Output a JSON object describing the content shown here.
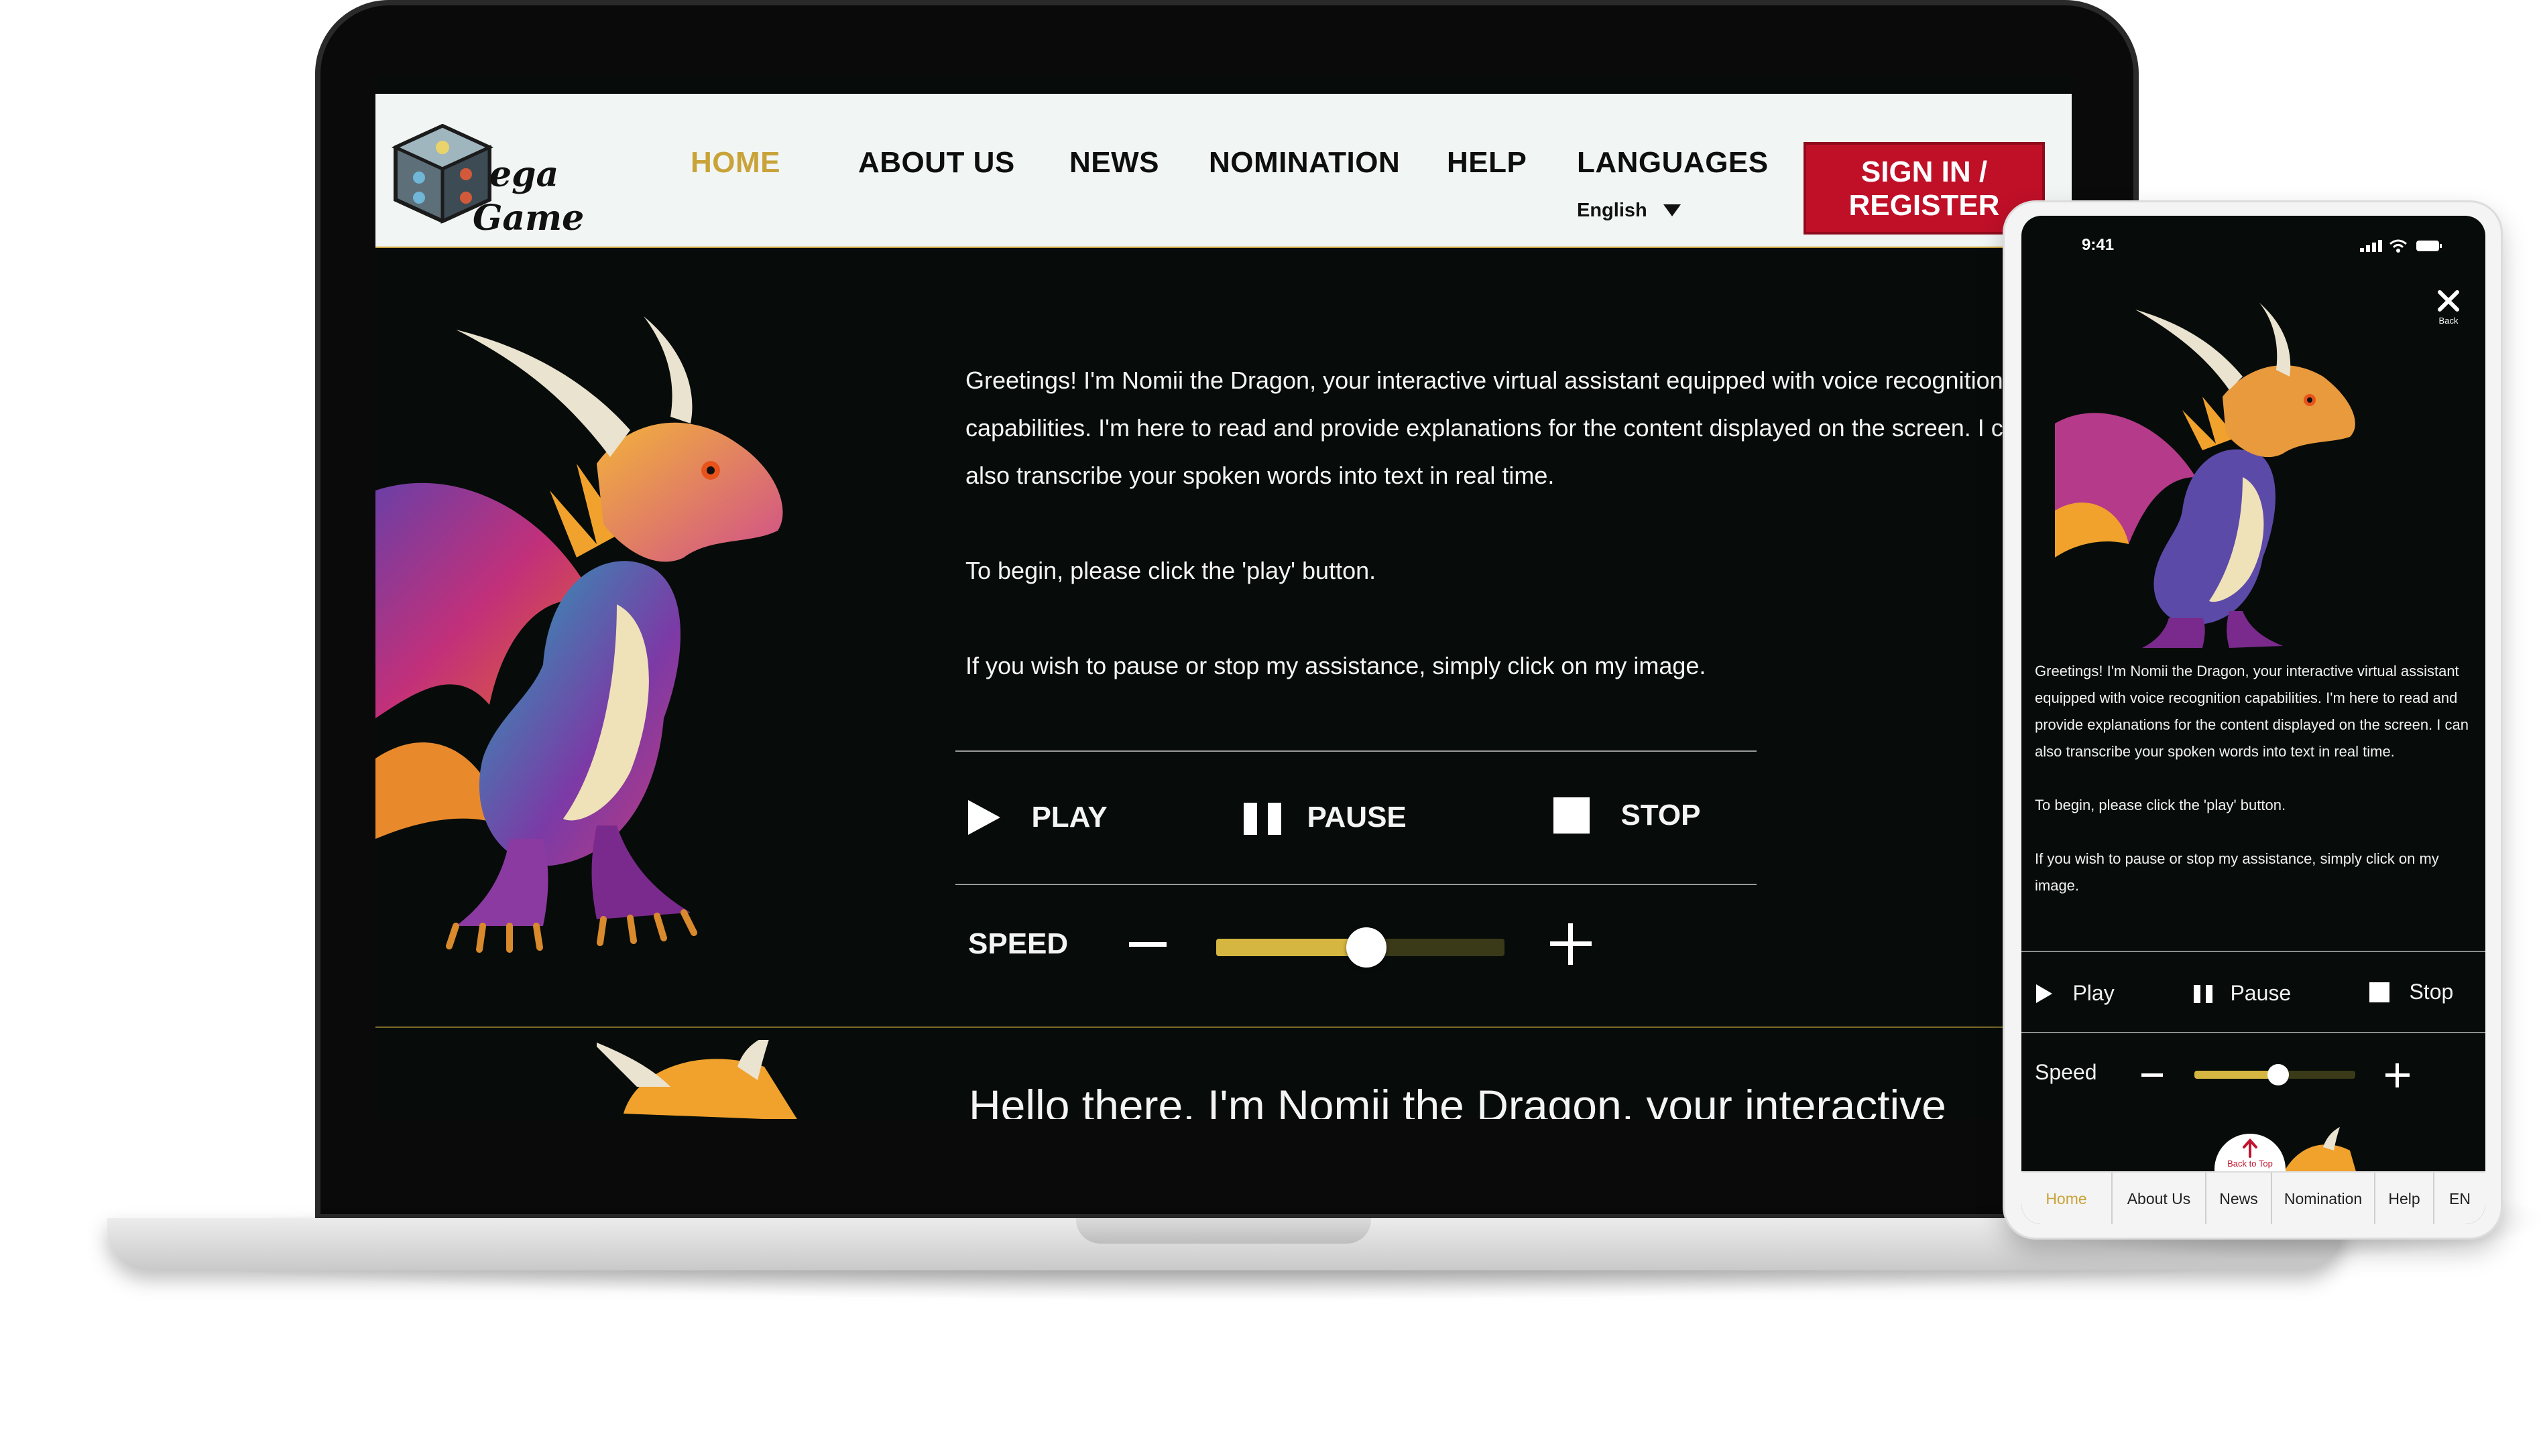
{
  "desktop": {
    "logo": {
      "text_line1": "ega",
      "text_line2": "Game"
    },
    "nav": {
      "home": "HOME",
      "about": "ABOUT US",
      "news": "NEWS",
      "nomination": "NOMINATION",
      "help": "HELP",
      "languages": "LANGUAGES",
      "language_value": "English",
      "signin_line1": "SIGN IN /",
      "signin_line2": "REGISTER"
    },
    "intro": {
      "p1": "Greetings! I'm Nomii the Dragon, your interactive virtual assistant equipped with voice recognition capabilities. I'm here to read and provide explanations for the content displayed on the screen. I can also transcribe your spoken words into text in real time.",
      "p2": "To begin, please click the 'play' button.",
      "p3": "If you wish to pause or stop my assistance, simply click on my image."
    },
    "controls": {
      "play": "PLAY",
      "pause": "PAUSE",
      "stop": "STOP",
      "speed": "SPEED",
      "speed_level": 0.52
    },
    "bottom_text": "Hello there, I'm Nomii the Dragon, your interactive"
  },
  "mobile": {
    "status_time": "9:41",
    "close_label": "Back",
    "intro": {
      "p1": "Greetings! I'm Nomii the Dragon, your interactive virtual assistant equipped with voice recognition capabilities. I'm here to read and provide explanations for the content displayed on the screen. I can also transcribe your spoken words into text in real time.",
      "p2": "To begin, please click the 'play' button.",
      "p3": "If you wish to pause or stop my assistance, simply click on my image."
    },
    "controls": {
      "play": "Play",
      "pause": "Pause",
      "stop": "Stop",
      "speed": "Speed",
      "speed_level": 0.52
    },
    "back_to_top": "Back to Top",
    "nav": [
      "Home",
      "About Us",
      "News",
      "Nomination",
      "Help",
      "EN"
    ]
  },
  "colors": {
    "accent_gold": "#c9a33a",
    "signin_red": "#bf1028",
    "bg_dark": "#070c0a"
  }
}
